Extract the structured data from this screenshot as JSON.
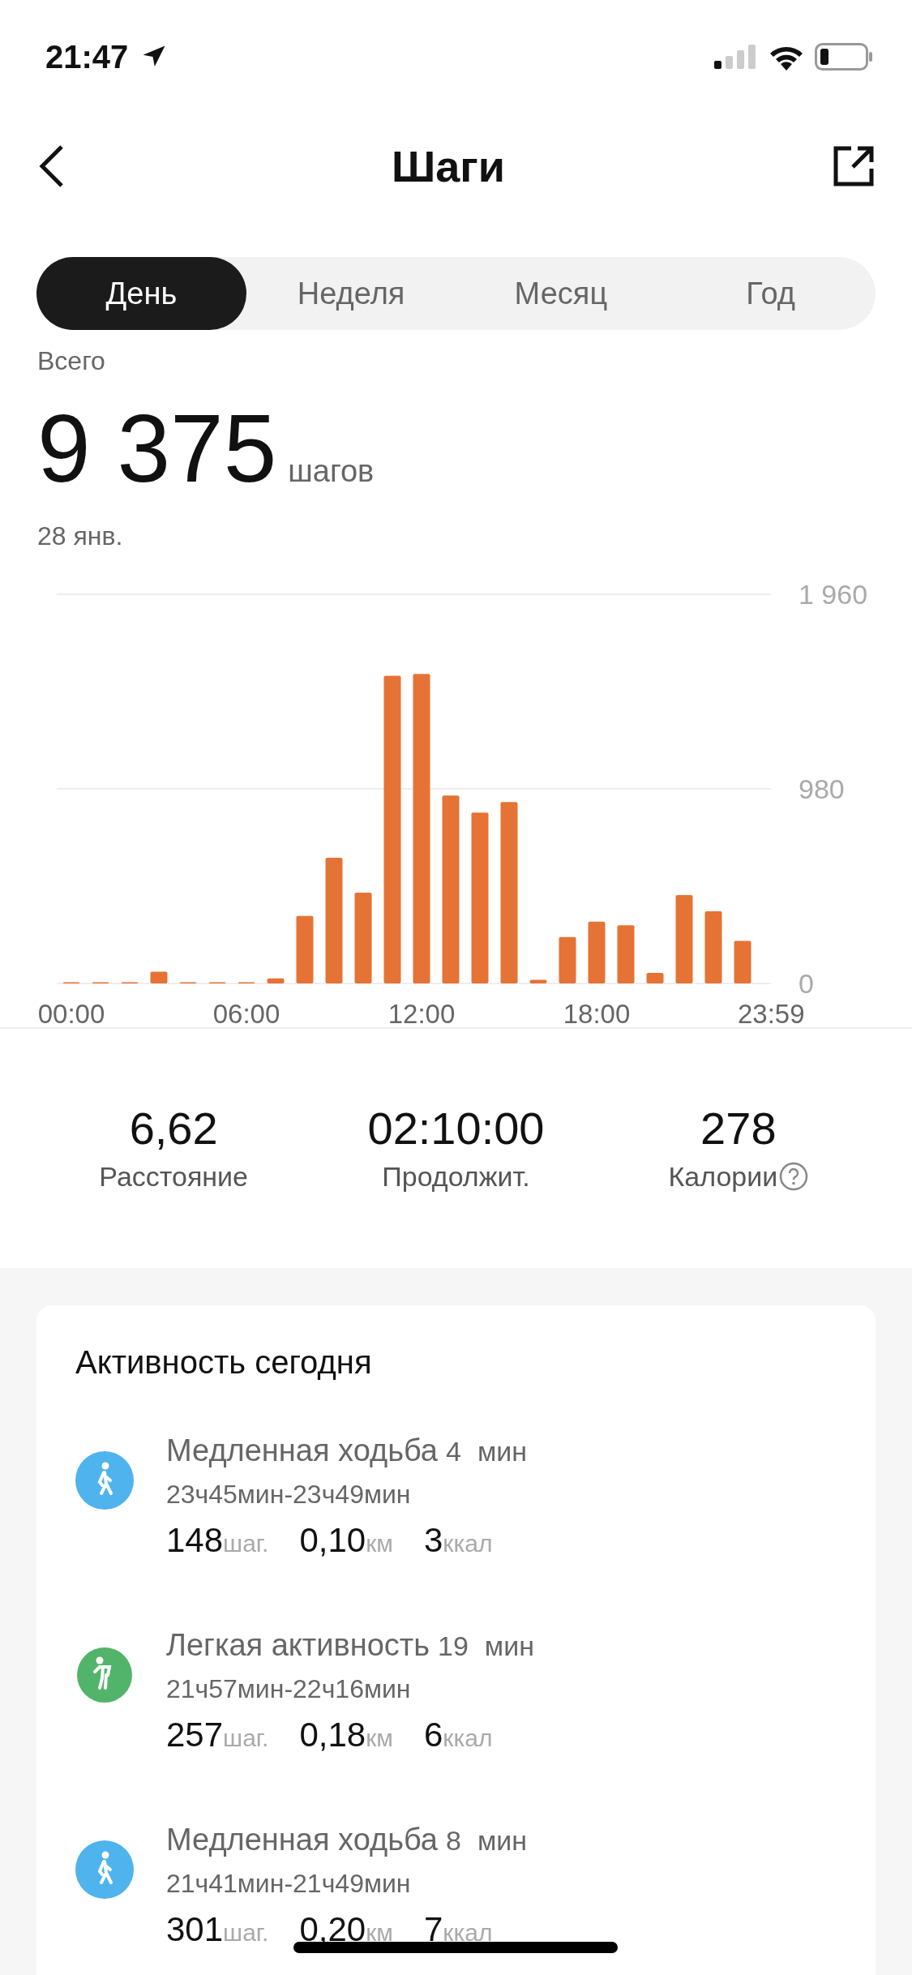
{
  "status_bar": {
    "time": "21:47"
  },
  "header": {
    "title": "Шаги"
  },
  "tabs": [
    {
      "label": "День",
      "selected": true
    },
    {
      "label": "Неделя",
      "selected": false
    },
    {
      "label": "Месяц",
      "selected": false
    },
    {
      "label": "Год",
      "selected": false
    }
  ],
  "summary": {
    "label": "Всего",
    "value": "9 375",
    "unit": "шагов",
    "date": "28 янв."
  },
  "chart_data": {
    "type": "bar",
    "x": [
      0,
      1,
      2,
      3,
      4,
      5,
      6,
      7,
      8,
      9,
      10,
      11,
      12,
      13,
      14,
      15,
      16,
      17,
      18,
      19,
      20,
      21,
      22,
      23
    ],
    "xlim": [
      -0.5,
      23.98
    ],
    "series": [
      {
        "color": "#e57335",
        "values": [
          5,
          0,
          0,
          59,
          5,
          0,
          5,
          26,
          340,
          633,
          457,
          1550,
          1559,
          946,
          861,
          914,
          18,
          234,
          311,
          293,
          53,
          445,
          363,
          214
        ]
      }
    ],
    "ylim": [
      0,
      1960
    ],
    "yticks": [
      0,
      980,
      {
        "value": 1960,
        "label": "1 960"
      }
    ],
    "xticks": [
      {
        "value": 0,
        "label": "00:00"
      },
      {
        "value": 6,
        "label": "06:00"
      },
      {
        "value": 12,
        "label": "12:00"
      },
      {
        "value": 18,
        "label": "18:00"
      },
      {
        "value": 23.98,
        "label": "23:59"
      }
    ]
  },
  "stats": [
    {
      "value": "6,62",
      "label": "Расстояние",
      "help": false
    },
    {
      "value": "02:10:00",
      "label": "Продолжит.",
      "help": false
    },
    {
      "value": "278",
      "label": "Калории",
      "help": true
    }
  ],
  "activity": {
    "title": "Активность сегодня",
    "items": [
      {
        "kind": "walk",
        "name": "Медленная ходьба",
        "duration": "4",
        "duration_unit": "мин",
        "time_range": "23ч45мин-23ч49мин",
        "steps": "148",
        "steps_unit": "шаг.",
        "distance": "0,10",
        "distance_unit": "км",
        "calories": "3",
        "calories_unit": "ккал"
      },
      {
        "kind": "light",
        "name": "Легкая активность",
        "duration": "19",
        "duration_unit": "мин",
        "time_range": "21ч57мин-22ч16мин",
        "steps": "257",
        "steps_unit": "шаг.",
        "distance": "0,18",
        "distance_unit": "км",
        "calories": "6",
        "calories_unit": "ккал"
      },
      {
        "kind": "walk",
        "name": "Медленная ходьба",
        "duration": "8",
        "duration_unit": "мин",
        "time_range": "21ч41мин-21ч49мин",
        "steps": "301",
        "steps_unit": "шаг.",
        "distance": "0,20",
        "distance_unit": "км",
        "calories": "7",
        "calories_unit": "ккал"
      }
    ]
  }
}
